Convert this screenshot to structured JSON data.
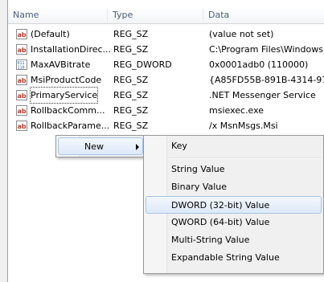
{
  "columns": {
    "name": "Name",
    "type": "Type",
    "data": "Data"
  },
  "rows": [
    {
      "name": "(Default)",
      "type": "REG_SZ",
      "data": "(value not set)",
      "icon": "string-value-icon"
    },
    {
      "name": "InstallationDirec...",
      "type": "REG_SZ",
      "data": "C:\\Program Files\\Windows",
      "icon": "string-value-icon"
    },
    {
      "name": "MaxAVBitrate",
      "type": "REG_DWORD",
      "data": "0x0001adb0 (110000)",
      "icon": "binary-value-icon"
    },
    {
      "name": "MsiProductCode",
      "type": "REG_SZ",
      "data": "{A85FD55B-891B-4314-97A",
      "icon": "string-value-icon"
    },
    {
      "name": "PrimaryService",
      "type": "REG_SZ",
      "data": ".NET Messenger Service",
      "icon": "string-value-icon"
    },
    {
      "name": "RollbackComm...",
      "type": "REG_SZ",
      "data": "msiexec.exe",
      "icon": "string-value-icon"
    },
    {
      "name": "RollbackParame...",
      "type": "REG_SZ",
      "data": "/x MsnMsgs.Msi",
      "icon": "string-value-icon"
    }
  ],
  "context_menu": {
    "new_label": "New"
  },
  "submenu": {
    "items": [
      "Key",
      "String Value",
      "Binary Value",
      "DWORD (32-bit) Value",
      "QWORD (64-bit) Value",
      "Multi-String Value",
      "Expandable String Value"
    ],
    "highlighted": "DWORD (32-bit) Value"
  },
  "colors": {
    "header_text": "#4c607a",
    "highlight_border": "#a6c4e6",
    "string_icon": "#c0392b",
    "binary_icon": "#2e6bb0"
  }
}
